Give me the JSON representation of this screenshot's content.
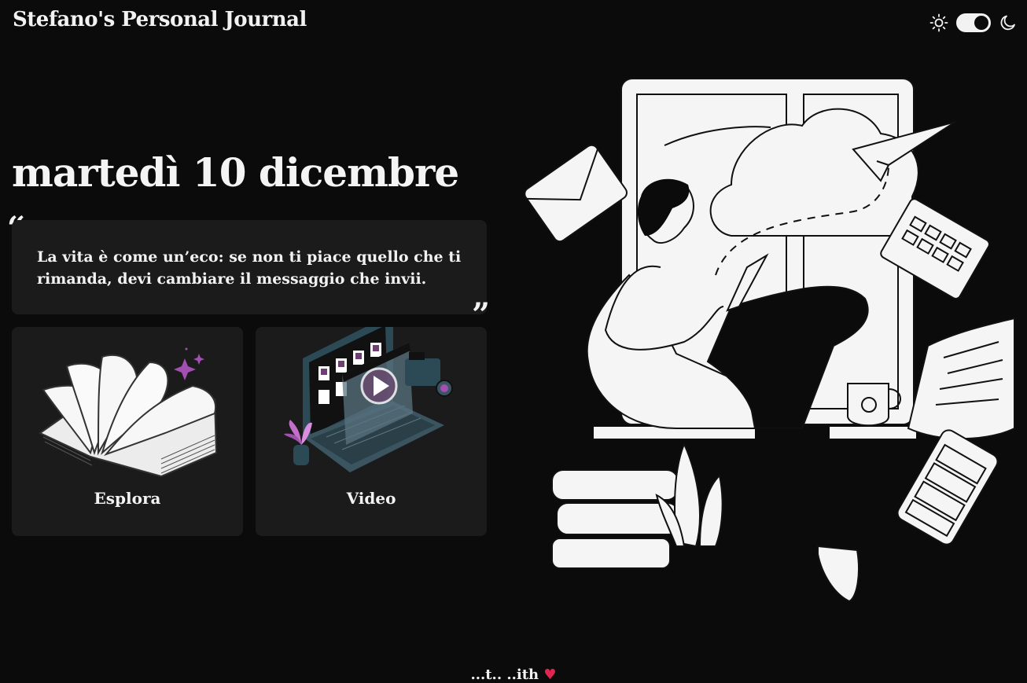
{
  "header": {
    "title": "Stefano's Personal Journal",
    "theme_toggle": {
      "light_icon": "sun-icon",
      "dark_icon": "moon-icon",
      "mode": "dark"
    }
  },
  "main": {
    "date": "martedì 10 dicembre",
    "quote": "La vita è come un’eco: se non ti piace quello che ti rimanda, devi cambiare il messaggio che invii.",
    "cards": [
      {
        "label": "Esplora",
        "icon": "open-book-illustration"
      },
      {
        "label": "Video",
        "icon": "laptop-video-illustration"
      }
    ],
    "hero_illustration": "person-reading-window-illustration"
  },
  "footer": {
    "text": "...t.. ..ith",
    "heart_icon": "♥"
  },
  "colors": {
    "background": "#0b0b0b",
    "card": "#1b1b1b",
    "text": "#f4f4f4",
    "accent_pink": "#e0264e",
    "sparkle_purple": "#a24fb2"
  }
}
